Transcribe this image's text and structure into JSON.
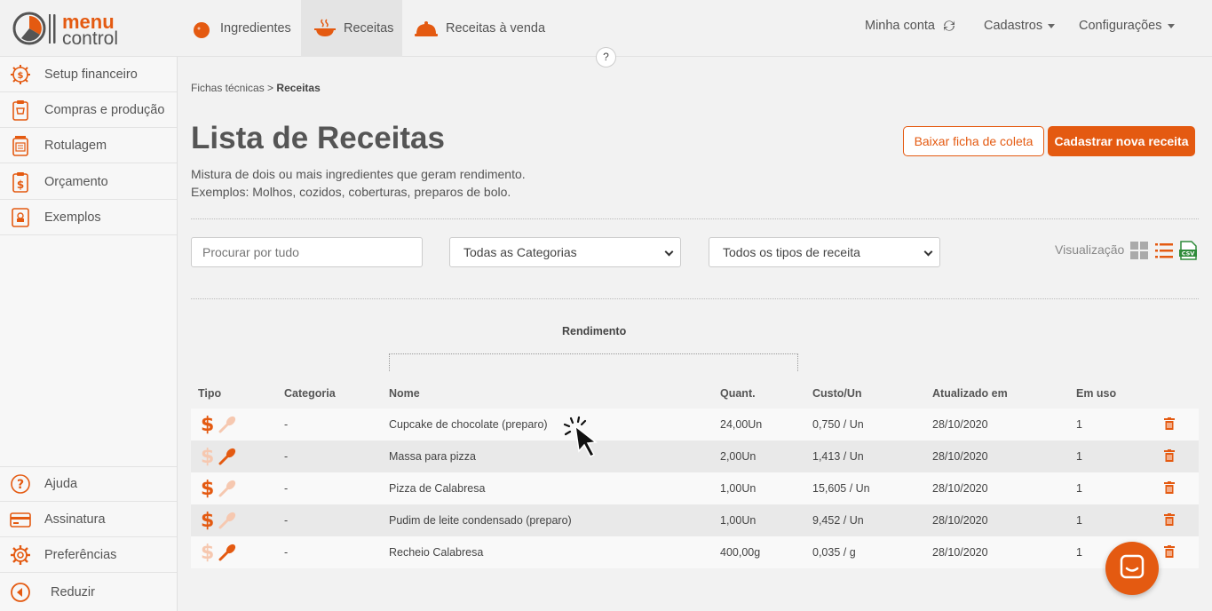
{
  "brand": {
    "name_top": "menu",
    "name_bottom": "control",
    "accent": "#e45a11"
  },
  "nav": {
    "items": [
      {
        "label": "Ingredientes",
        "icon": "tomato-icon"
      },
      {
        "label": "Receitas",
        "icon": "cooking-pot-icon",
        "active": true
      },
      {
        "label": "Receitas à venda",
        "icon": "serving-cloche-icon"
      }
    ],
    "account": "Minha conta",
    "cadastros": "Cadastros",
    "configuracoes": "Configurações",
    "help": "?"
  },
  "sidebar": {
    "items": [
      {
        "label": "Setup financeiro",
        "icon": "dollar-gear-icon"
      },
      {
        "label": "Compras e produção",
        "icon": "shopping-clipboard-icon"
      },
      {
        "label": "Rotulagem",
        "icon": "label-jar-icon"
      },
      {
        "label": "Orçamento",
        "icon": "budget-clipboard-icon"
      },
      {
        "label": "Exemplos",
        "icon": "recipe-book-icon"
      }
    ],
    "bottom": [
      {
        "label": "Ajuda",
        "icon": "question-icon"
      },
      {
        "label": "Assinatura",
        "icon": "credit-card-icon"
      },
      {
        "label": "Preferências",
        "icon": "gear-icon"
      },
      {
        "label": "Reduzir",
        "icon": "collapse-left-icon"
      }
    ]
  },
  "page": {
    "breadcrumb_parent": "Fichas técnicas",
    "breadcrumb_sep": ">",
    "breadcrumb_current": "Receitas",
    "title": "Lista de Receitas",
    "desc_line1": "Mistura de dois ou mais ingredientes que geram rendimento.",
    "desc_line2": "Exemplos: Molhos, cozidos, coberturas, preparos de bolo.",
    "btn_download": "Baixar ficha de coleta",
    "btn_new": "Cadastrar nova receita"
  },
  "filters": {
    "search_placeholder": "Procurar por tudo",
    "category": "Todas as Categorias",
    "type": "Todos os tipos de receita",
    "view_label": "Visualização"
  },
  "table": {
    "group_label": "Rendimento",
    "headers": {
      "tipo": "Tipo",
      "categoria": "Categoria",
      "nome": "Nome",
      "quant": "Quant.",
      "custo": "Custo/Un",
      "atualizado": "Atualizado em",
      "emuso": "Em uso"
    },
    "rows": [
      {
        "sale": true,
        "prep": false,
        "categoria": "-",
        "nome": "Cupcake de chocolate (preparo)",
        "quant": "24,00Un",
        "custo": "0,750 / Un",
        "atualizado": "28/10/2020",
        "emuso": "1"
      },
      {
        "sale": false,
        "prep": true,
        "categoria": "-",
        "nome": "Massa para pizza",
        "quant": "2,00Un",
        "custo": "1,413 / Un",
        "atualizado": "28/10/2020",
        "emuso": "1"
      },
      {
        "sale": true,
        "prep": false,
        "categoria": "-",
        "nome": "Pizza de Calabresa",
        "quant": "1,00Un",
        "custo": "15,605 / Un",
        "atualizado": "28/10/2020",
        "emuso": "1"
      },
      {
        "sale": true,
        "prep": false,
        "categoria": "-",
        "nome": "Pudim de leite condensado (preparo)",
        "quant": "1,00Un",
        "custo": "9,452 / Un",
        "atualizado": "28/10/2020",
        "emuso": "1"
      },
      {
        "sale": false,
        "prep": true,
        "categoria": "-",
        "nome": "Recheio Calabresa",
        "quant": "400,00g",
        "custo": "0,035 / g",
        "atualizado": "28/10/2020",
        "emuso": "1"
      }
    ]
  }
}
